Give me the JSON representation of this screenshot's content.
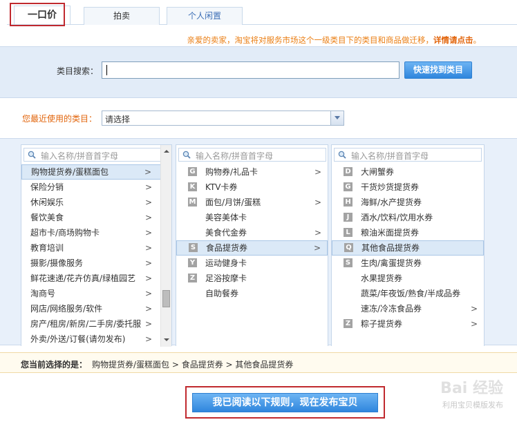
{
  "tabs": [
    {
      "label": "一口价",
      "active": true
    },
    {
      "label": "拍卖",
      "active": false
    },
    {
      "label": "个人闲置",
      "active": false
    }
  ],
  "notice": {
    "text": "亲爱的卖家，淘宝将对服务市场这个一级类目下的类目和商品做迁移，",
    "link": "详情请点击",
    "suffix": "。"
  },
  "search": {
    "label": "类目搜索：",
    "value": "",
    "button_label": "快速找到类目"
  },
  "recent": {
    "label": "您最近使用的类目：",
    "selected": "请选择"
  },
  "column_search_placeholder": "输入名称/拼音首字母",
  "columns": [
    {
      "items": [
        {
          "label": "购物提货券/蛋糕面包",
          "has_children": true,
          "selected": true
        },
        {
          "label": "保险分销",
          "has_children": true
        },
        {
          "label": "休闲娱乐",
          "has_children": true
        },
        {
          "label": "餐饮美食",
          "has_children": true
        },
        {
          "label": "超市卡/商场购物卡",
          "has_children": true
        },
        {
          "label": "教育培训",
          "has_children": true
        },
        {
          "label": "摄影/摄像服务",
          "has_children": true
        },
        {
          "label": "鲜花速递/花卉仿真/绿植园艺",
          "has_children": true
        },
        {
          "label": "淘商号",
          "has_children": true
        },
        {
          "label": "网店/网络服务/软件",
          "has_children": true
        },
        {
          "label": "房产/租房/新房/二手房/委托服",
          "has_children": true
        },
        {
          "label": "外卖/外送/订餐(请勿发布)",
          "has_children": true
        }
      ]
    },
    {
      "items": [
        {
          "key": "G",
          "label": "购物券/礼品卡",
          "has_children": true
        },
        {
          "key": "K",
          "label": "KTV卡券",
          "has_children": false
        },
        {
          "key": "M",
          "label": "面包/月饼/蛋糕",
          "has_children": true
        },
        {
          "key": "",
          "label": "美容美体卡",
          "has_children": false
        },
        {
          "key": "",
          "label": "美食代金券",
          "has_children": true
        },
        {
          "key": "S",
          "label": "食品提货券",
          "has_children": true,
          "selected": true
        },
        {
          "key": "Y",
          "label": "运动健身卡",
          "has_children": false
        },
        {
          "key": "Z",
          "label": "足浴按摩卡",
          "has_children": false
        },
        {
          "key": "",
          "label": "自助餐券",
          "has_children": false
        }
      ]
    },
    {
      "items": [
        {
          "key": "D",
          "label": "大闸蟹券",
          "has_children": false
        },
        {
          "key": "G",
          "label": "干货炒货提货券",
          "has_children": false
        },
        {
          "key": "H",
          "label": "海鲜/水产提货券",
          "has_children": false
        },
        {
          "key": "J",
          "label": "酒水/饮料/饮用水券",
          "has_children": false
        },
        {
          "key": "L",
          "label": "粮油米面提货券",
          "has_children": false
        },
        {
          "key": "Q",
          "label": "其他食品提货券",
          "has_children": false,
          "selected": true
        },
        {
          "key": "S",
          "label": "生肉/禽蛋提货券",
          "has_children": false
        },
        {
          "key": "",
          "label": "水果提货券",
          "has_children": false
        },
        {
          "key": "",
          "label": "蔬菜/年夜饭/熟食/半成品券",
          "has_children": false
        },
        {
          "key": "",
          "label": "速冻/冷冻食品券",
          "has_children": true
        },
        {
          "key": "Z",
          "label": "粽子提货券",
          "has_children": true
        }
      ]
    }
  ],
  "path": {
    "lead": "您当前选择的是：",
    "value": "购物提货券/蛋糕面包 > 食品提货券 > 其他食品提货券"
  },
  "publish_button_label": "我已阅读以下规则，现在发布宝贝",
  "watermark": {
    "brand": "Bai 经验",
    "caption": "利用宝贝模版发布"
  },
  "colors": {
    "accent_blue": "#2f86dd",
    "panel_bg": "#e2ecf8",
    "highlight": "#c0292e",
    "notice_orange": "#ea7e13"
  }
}
